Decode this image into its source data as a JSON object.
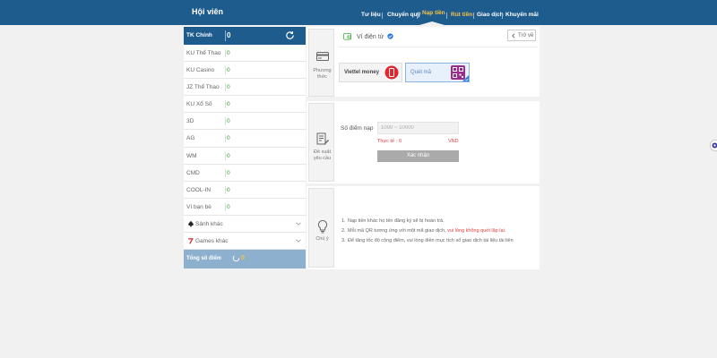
{
  "header": {
    "title": "Hội viên",
    "nav": [
      {
        "label": "Tư liệu",
        "active": false
      },
      {
        "label": "Chuyển quỹ",
        "active": false
      },
      {
        "label": "Nạp tiền",
        "active": true
      },
      {
        "label": "Rút tiền",
        "active": false
      },
      {
        "label": "Giao dịch",
        "active": false
      },
      {
        "label": "Khuyến mãi",
        "active": false
      }
    ]
  },
  "sidebar": {
    "main_account": {
      "label": "TK Chính",
      "value": "0"
    },
    "accounts": [
      {
        "label": "KU Thể Thao",
        "value": "0"
      },
      {
        "label": "KU Casino",
        "value": "0"
      },
      {
        "label": "JZ Thể Thao",
        "value": "0"
      },
      {
        "label": "KU Xổ Số",
        "value": "0"
      },
      {
        "label": "3D",
        "value": "0"
      },
      {
        "label": "AG",
        "value": "0"
      },
      {
        "label": "WM",
        "value": "0"
      },
      {
        "label": "CMD",
        "value": "0"
      },
      {
        "label": "COOL-IN",
        "value": "0"
      },
      {
        "label": "Ví bạn bè",
        "value": "0"
      }
    ],
    "more_groups": [
      {
        "label": "Sảnh khác",
        "icon": "spade-icon"
      },
      {
        "label": "Games khác",
        "icon": "slot-seven-icon"
      }
    ],
    "total": {
      "label": "Tổng số điểm",
      "value": "0"
    }
  },
  "method_panel": {
    "side_label_1": "Phương",
    "side_label_2": "thức",
    "wallet_label": "Ví điện tử",
    "back_label": "Trở về",
    "methods": [
      {
        "label": "Viettel money",
        "selected": false
      },
      {
        "label": "Quét mã",
        "selected": true
      }
    ]
  },
  "request_panel": {
    "side_label_1": "Đề xuất",
    "side_label_2": "yêu cầu",
    "amount_label": "Số điểm nạp",
    "amount_placeholder": "1000 ~ 10000",
    "amount_value": "",
    "real_label": "Thực tế :",
    "real_value": "0",
    "unit": "VND",
    "submit_label": "Xác nhận"
  },
  "notes_panel": {
    "side_label": "Chú ý",
    "notes": [
      {
        "num": "1.",
        "text": "Nạp tiền khác họ tên đăng ký sẽ bị hoàn trả.",
        "highlight": ""
      },
      {
        "num": "2.",
        "text": "Mỗi mã QR tương ứng với một mã giao dịch,",
        "highlight": " vui lòng không quét lặp lại."
      },
      {
        "num": "3.",
        "text": "Để tăng tốc độ cộng điểm, vui lòng điền mục tích số giao dịch tài liệu tài liên",
        "highlight": ""
      }
    ]
  },
  "colors": {
    "primary": "#1f5c8e",
    "accent": "#f6c343",
    "danger": "#e43c3c",
    "success": "#2aa52a"
  }
}
